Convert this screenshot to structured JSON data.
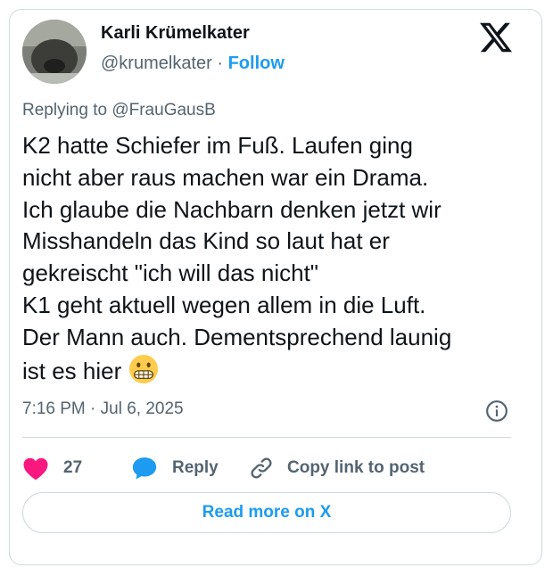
{
  "author": {
    "name": "Karli Krümelkater",
    "handle": "@krumelkater",
    "separator": "·",
    "follow_label": "Follow"
  },
  "reply_context": "Replying to @FrauGausB",
  "tweet_text": "K2 hatte Schiefer im Fuß. Laufen ging\nnicht aber raus machen war ein Drama.\nIch glaube die Nachbarn denken jetzt wir\nMisshandeln das Kind so laut hat er\ngekreischt \"ich will das nicht\"\nK1 geht aktuell wegen allem in die Luft.\nDer Mann auch. Dementsprechend launig\nist es hier ",
  "timestamp": "7:16 PM · Jul 6, 2025",
  "actions": {
    "like_count": "27",
    "reply_label": "Reply",
    "copy_label": "Copy link to post"
  },
  "read_more_label": "Read more on X",
  "icons": {
    "logo": "x-logo-icon",
    "emoji": "grimacing-face-emoji",
    "info": "info-icon",
    "like": "heart-icon",
    "reply": "speech-bubble-icon",
    "copy": "link-icon"
  },
  "colors": {
    "accent": "#1d9bf0",
    "like": "#f91880",
    "secondary_text": "#536471",
    "border": "#cfd9de"
  }
}
